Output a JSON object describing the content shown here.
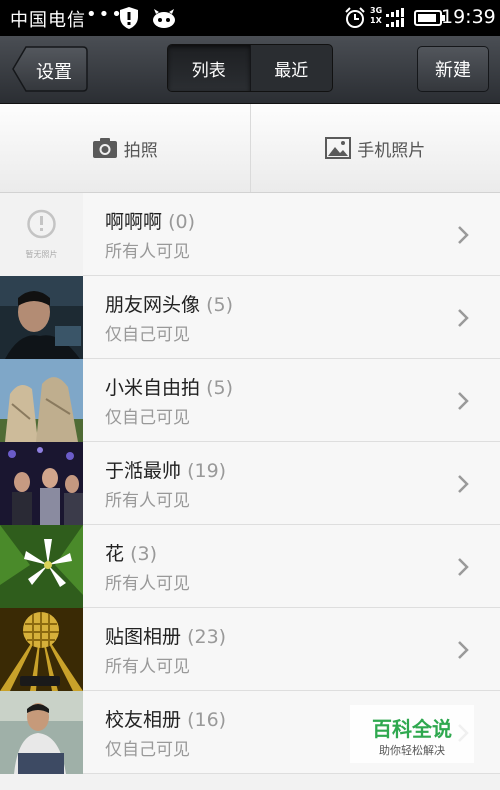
{
  "status_bar": {
    "carrier": "中国电信",
    "dots": "•••",
    "network": [
      "3G",
      "1X"
    ],
    "time": "19:39"
  },
  "action_bar": {
    "back_label": "设置",
    "tabs": [
      {
        "label": "列表",
        "active": true
      },
      {
        "label": "最近",
        "active": false
      }
    ],
    "new_label": "新建"
  },
  "source_bar": {
    "camera_label": "拍照",
    "gallery_label": "手机照片"
  },
  "albums": [
    {
      "title": "啊啊啊",
      "count": "(0)",
      "privacy": "所有人可见",
      "thumb": "empty",
      "empty_text": "暂无照片"
    },
    {
      "title": "朋友网头像",
      "count": "(5)",
      "privacy": "仅自己可见",
      "thumb": "portrait-dark"
    },
    {
      "title": "小米自由拍",
      "count": "(5)",
      "privacy": "仅自己可见",
      "thumb": "stone-sculpture"
    },
    {
      "title": "于湉最帅",
      "count": "(19)",
      "privacy": "所有人可见",
      "thumb": "stage-group"
    },
    {
      "title": "花",
      "count": "(3)",
      "privacy": "所有人可见",
      "thumb": "white-lily"
    },
    {
      "title": "贴图相册",
      "count": "(23)",
      "privacy": "所有人可见",
      "thumb": "disco-ball"
    },
    {
      "title": "校友相册",
      "count": "(16)",
      "privacy": "仅自己可见",
      "thumb": "seated-man"
    }
  ],
  "watermark": {
    "main": "百科全说",
    "sub": "助你轻松解决"
  },
  "colors": {
    "status_bar_bg": "#000000",
    "action_bar_bg": "#3a3d42",
    "list_bg": "#f7f7f7",
    "watermark_green": "#2fa84f"
  }
}
